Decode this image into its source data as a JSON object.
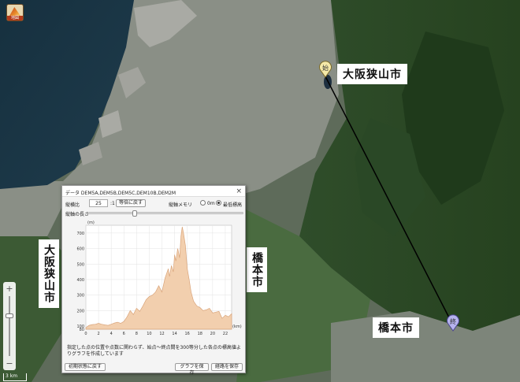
{
  "app": {
    "icon_text": "地図"
  },
  "map_labels": {
    "start_city": "大阪狭山市",
    "end_city": "橋本市",
    "left_city": "大阪狭山市",
    "right_city": "橋本市"
  },
  "markers": {
    "start": "始",
    "end": "終"
  },
  "map_controls": {
    "zoom_in": "+",
    "zoom_out": "−",
    "scale_text": "3 km"
  },
  "dialog": {
    "title": "データ  DEM5A,DEM5B,DEM5C,DEM10B,DEM2M",
    "close": "×",
    "ratio_label": "縦横比",
    "ratio_value": "25",
    "ratio_suffix": ":1",
    "reset_ratio_button": "等倍に戻す",
    "memo_label": "縦軸メモリ",
    "option_zero": "0m",
    "option_min": "最低標高",
    "axis_length_label": "縦軸の長さ",
    "note": "指定した点の位置や点数に関わらず、始点〜終点間を300等分した各点の標高値よりグラフを作成しています",
    "initial_state_button": "初期状態に戻す",
    "save_graph_button": "グラフを保存",
    "save_route_button": "経路を保存"
  },
  "colors": {
    "profile_fill": "#f2cfae",
    "profile_stroke": "#d9a47a",
    "route_line": "#000000"
  },
  "chart_data": {
    "type": "area",
    "xlabel": "(km)",
    "ylabel": "(m)",
    "xlim": [
      0,
      23
    ],
    "ylim": [
      80,
      750
    ],
    "x_ticks": [
      0,
      2,
      4,
      6,
      8,
      10,
      12,
      14,
      16,
      18,
      20,
      22
    ],
    "y_ticks": [
      80,
      100,
      200,
      300,
      400,
      500,
      600,
      700
    ],
    "grid": true,
    "x": [
      0,
      0.5,
      1,
      1.5,
      2,
      2.5,
      3,
      3.5,
      4,
      4.5,
      5,
      5.5,
      6,
      6.5,
      7,
      7.5,
      8,
      8.5,
      9,
      9.5,
      10,
      10.5,
      11,
      11.5,
      12,
      12.5,
      13,
      13.2,
      13.5,
      13.8,
      14,
      14.2,
      14.5,
      14.8,
      15,
      15.2,
      15.4,
      15.7,
      16,
      16.3,
      16.6,
      17,
      17.5,
      18,
      18.5,
      19,
      19.5,
      20,
      20.5,
      21,
      21.5,
      22,
      22.5,
      23
    ],
    "y": [
      90,
      105,
      110,
      112,
      118,
      112,
      108,
      105,
      112,
      120,
      125,
      118,
      130,
      160,
      200,
      175,
      215,
      195,
      230,
      270,
      290,
      300,
      320,
      360,
      320,
      410,
      470,
      420,
      490,
      450,
      560,
      520,
      600,
      540,
      680,
      740,
      700,
      620,
      470,
      400,
      320,
      260,
      230,
      220,
      200,
      205,
      215,
      185,
      190,
      195,
      150,
      170,
      160,
      180
    ]
  }
}
